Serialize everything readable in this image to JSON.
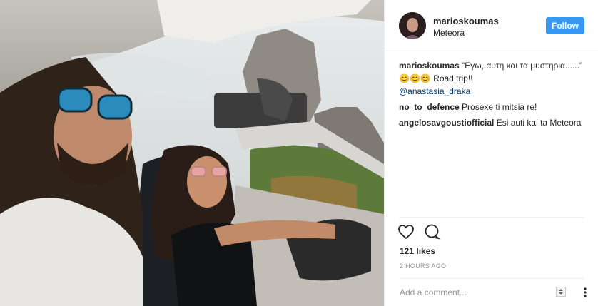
{
  "post": {
    "username": "marioskoumas",
    "location": "Meteora",
    "follow_label": "Follow",
    "caption": {
      "username": "marioskoumas",
      "text": "\"Εγω, αυτη και τα μυστηρια......\" 😊😊😊 Road trip!!",
      "mention": "@anastasia_draka"
    },
    "comments": [
      {
        "username": "no_to_defence",
        "text": "Prosexe ti mitsia re!"
      },
      {
        "username": "angelosavgoustiofficial",
        "text": "Esi auti kai ta Meteora"
      }
    ],
    "likes": "121 likes",
    "time": "2 HOURS AGO",
    "add_comment_placeholder": "Add a comment..."
  },
  "colors": {
    "accent": "#3897f0",
    "mention": "#003569",
    "muted": "#999999"
  },
  "icons": {
    "like": "heart-icon",
    "comment": "comment-icon",
    "more": "more-options-icon"
  }
}
